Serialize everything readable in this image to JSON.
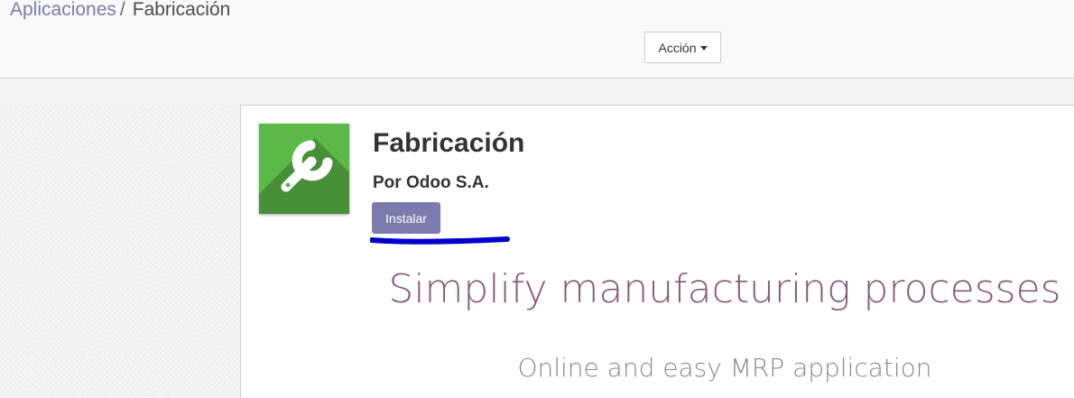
{
  "breadcrumb": {
    "parent": "Aplicaciones",
    "separator": "/",
    "current": "Fabricación"
  },
  "toolbar": {
    "action_label": "Acción"
  },
  "app": {
    "title": "Fabricación",
    "author": "Por Odoo S.A.",
    "install_label": "Instalar",
    "icon": "wrench-icon",
    "icon_color": "#5bb947"
  },
  "description": {
    "headline": "Simplify manufacturing processes",
    "subheadline": "Online and easy MRP application"
  },
  "colors": {
    "accent": "#7c7bad",
    "headline": "#875a7b",
    "annotation": "#0000cc"
  }
}
